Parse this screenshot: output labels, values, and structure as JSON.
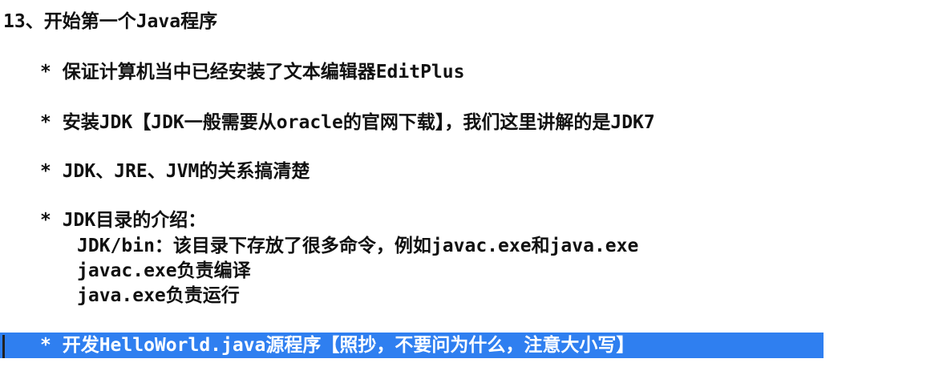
{
  "document": {
    "title": "13、开始第一个Java程序",
    "bullets": [
      "* 保证计算机当中已经安装了文本编辑器EditPlus",
      "* 安装JDK【JDK一般需要从oracle的官网下载】，我们这里讲解的是JDK7",
      "* JDK、JRE、JVM的关系搞清楚",
      "* JDK目录的介绍："
    ],
    "sub_lines": [
      "JDK/bin：该目录下存放了很多命令，例如javac.exe和java.exe",
      "javac.exe负责编译",
      "java.exe负责运行"
    ],
    "selected_line": "* 开发HelloWorld.java源程序【照抄，不要问为什么，注意大小写】"
  },
  "colors": {
    "text": "#111111",
    "selection_background": "#2f7ff0",
    "selection_text": "#ffffff"
  }
}
